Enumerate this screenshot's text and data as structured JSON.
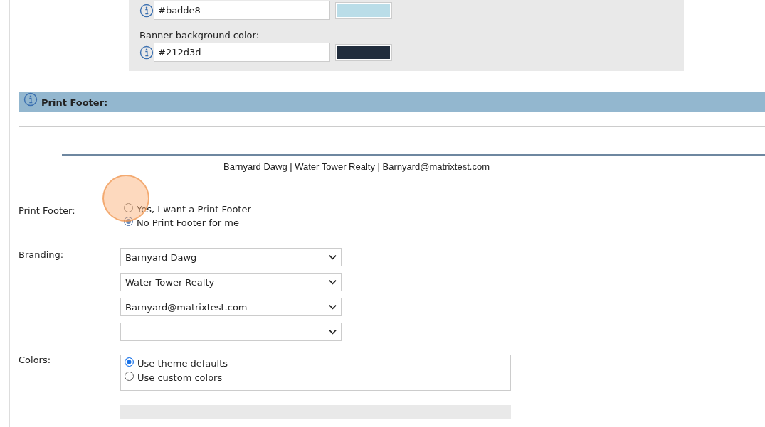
{
  "color_panel": {
    "fields": [
      {
        "value": "#badde8"
      },
      {
        "label": "Banner background color:",
        "value": "#212d3d"
      }
    ]
  },
  "print_footer_section": {
    "title": "Print Footer:",
    "preview": {
      "text": "Barnyard Dawg | Water Tower Realty | Barnyard@matrixtest.com"
    }
  },
  "print_footer": {
    "label": "Print Footer:",
    "options": [
      {
        "label": "Yes, I want a Print Footer",
        "selected": false
      },
      {
        "label": "No Print Footer for me",
        "selected": true
      }
    ]
  },
  "branding": {
    "label": "Branding:",
    "selects": [
      {
        "kind": "filled",
        "value": "Barnyard Dawg"
      },
      {
        "kind": "filled",
        "value": "Water Tower Realty"
      },
      {
        "kind": "filled",
        "value": "Barnyard@matrixtest.com"
      },
      {
        "kind": "blank"
      }
    ]
  },
  "colors": {
    "label": "Colors:",
    "options": [
      {
        "label": "Use theme defaults",
        "selected": true
      },
      {
        "label": "Use custom colors",
        "selected": false
      }
    ]
  }
}
